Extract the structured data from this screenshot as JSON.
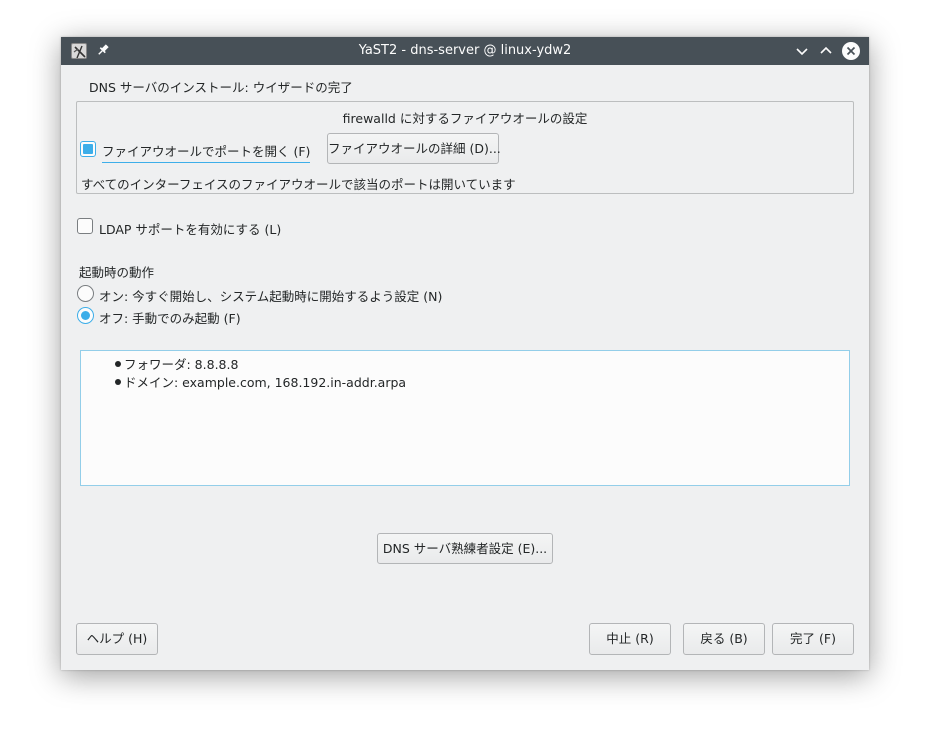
{
  "window": {
    "title": "YaST2 - dns-server @ linux-ydw2",
    "icons": [
      "yast-app-icon",
      "pin-icon",
      "minimize-icon",
      "maximize-icon",
      "close-icon"
    ]
  },
  "heading": "DNS サーバのインストール: ウイザードの完了",
  "firewall": {
    "group_title": "firewalld に対するファイアウオールの設定",
    "open_port_label": "ファイアウオールでポートを開く (F)",
    "open_port_checked": true,
    "details_button": "ファイアウオールの詳細 (D)...",
    "status": "すべてのインターフェイスのファイアウオールで該当のポートは開いています"
  },
  "ldap": {
    "label": "LDAP サポートを有効にする (L)",
    "checked": false
  },
  "startup": {
    "label": "起動時の動作",
    "options": [
      {
        "label": "オン: 今すぐ開始し、システム起動時に開始するよう設定 (N)",
        "selected": false
      },
      {
        "label": "オフ: 手動でのみ起動 (F)",
        "selected": true
      }
    ]
  },
  "summary": {
    "items": [
      "フォワーダ: 8.8.8.8",
      "ドメイン: example.com, 168.192.in-addr.arpa"
    ]
  },
  "expert_button": "DNS サーバ熟練者設定 (E)...",
  "footer": {
    "help": "ヘルプ (H)",
    "abort": "中止 (R)",
    "back": "戻る (B)",
    "finish": "完了 (F)"
  },
  "colors": {
    "accent": "#3daee9",
    "titlebar": "#475057",
    "window_bg": "#eff0f1"
  }
}
